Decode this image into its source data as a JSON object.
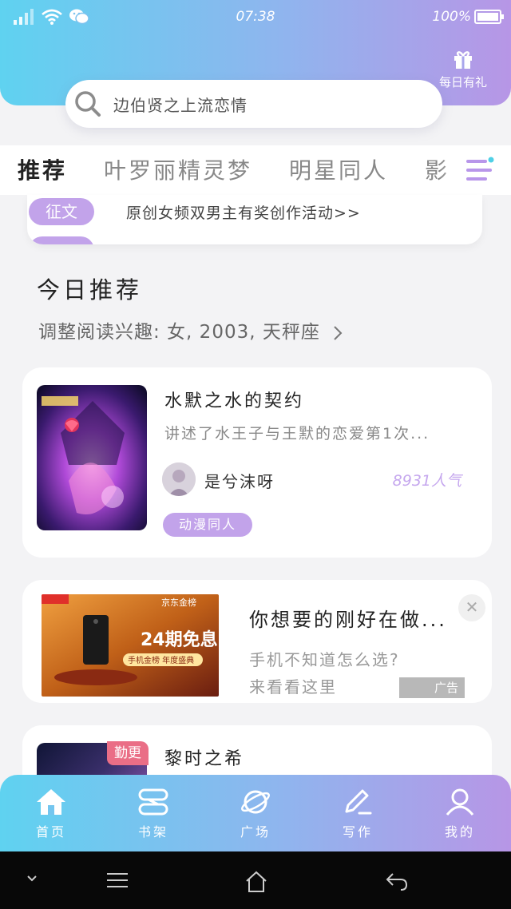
{
  "status_bar": {
    "time": "07:38",
    "battery": "100%"
  },
  "header": {
    "gift_label": "每日有礼"
  },
  "search": {
    "placeholder": "边伯贤之上流恋情"
  },
  "tabs": [
    {
      "label": "推荐",
      "active": true
    },
    {
      "label": "叶罗丽精灵梦",
      "active": false
    },
    {
      "label": "明星同人",
      "active": false
    },
    {
      "label": "影",
      "active": false
    }
  ],
  "activity": {
    "tag": "征文",
    "text": "原创女频双男主有奖创作活动>>"
  },
  "recommend": {
    "title": "今日推荐",
    "subtitle": "调整阅读兴趣: 女, 2003, 天秤座"
  },
  "book1": {
    "title": "水默之水的契约",
    "description": "讲述了水王子与王默的恋爱第1次...",
    "author": "是兮沫呀",
    "popularity": "8931人气",
    "genre": "动漫同人"
  },
  "ad": {
    "title": "你想要的刚好在做...",
    "line1": "手机不知道怎么选?",
    "line2": "来看看这里",
    "badge": "广告",
    "image_text": {
      "brand": "京东金榜",
      "promo": "24期免息",
      "sub": "手机金榜 年度盛典"
    }
  },
  "book2": {
    "title": "黎时之希",
    "badge": "勤更"
  },
  "bottom_nav": [
    {
      "label": "首页",
      "icon": "home-icon"
    },
    {
      "label": "书架",
      "icon": "bookshelf-icon"
    },
    {
      "label": "广场",
      "icon": "planet-icon"
    },
    {
      "label": "写作",
      "icon": "pen-icon"
    },
    {
      "label": "我的",
      "icon": "profile-icon"
    }
  ]
}
